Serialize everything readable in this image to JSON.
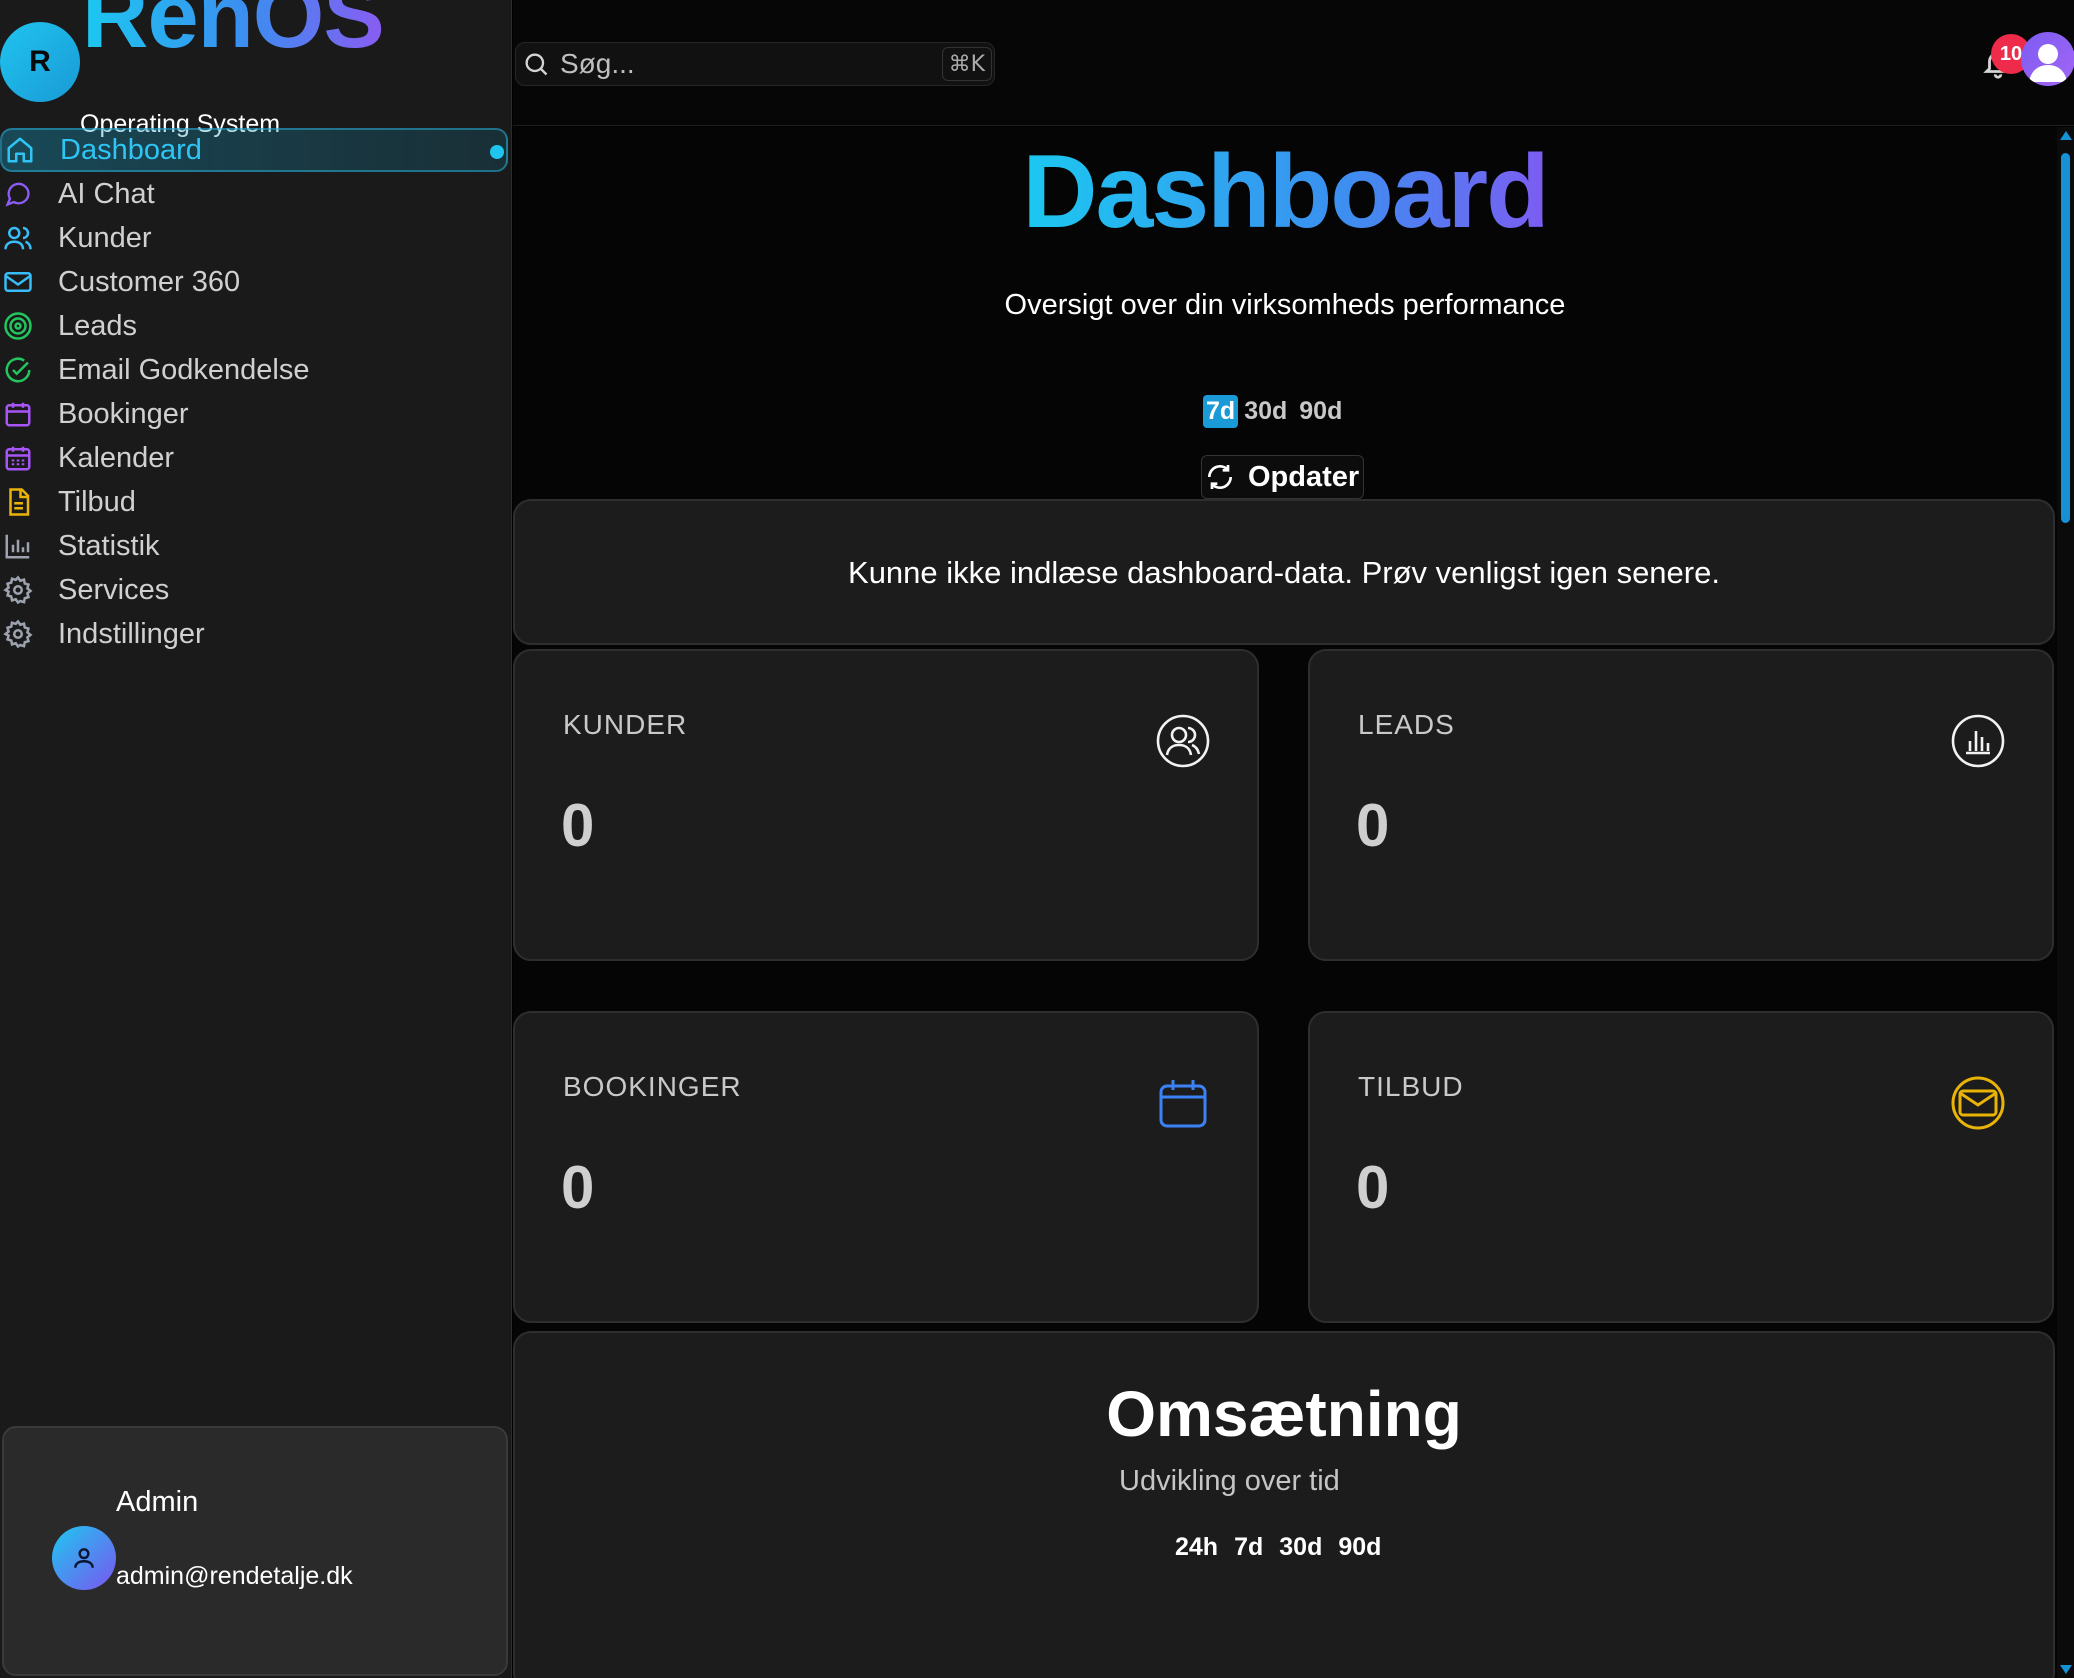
{
  "brand": {
    "logo_letter": "R",
    "name": "RenOS",
    "subtitle": "Operating System"
  },
  "colors": {
    "accent": "#1fc4ef",
    "gradient_end": "#7c5cf2",
    "badge": "#ee2b4b",
    "booking_icon": "#3b82f6",
    "tilbud_icon": "#eab308"
  },
  "sidebar": {
    "items": [
      {
        "label": "Dashboard",
        "icon": "home-icon",
        "active": true
      },
      {
        "label": "AI Chat",
        "icon": "chat-icon"
      },
      {
        "label": "Kunder",
        "icon": "users-icon"
      },
      {
        "label": "Customer 360",
        "icon": "mail-icon"
      },
      {
        "label": "Leads",
        "icon": "target-icon"
      },
      {
        "label": "Email Godkendelse",
        "icon": "check-circle-icon"
      },
      {
        "label": "Bookinger",
        "icon": "calendar-icon"
      },
      {
        "label": "Kalender",
        "icon": "calendar-grid-icon"
      },
      {
        "label": "Tilbud",
        "icon": "document-icon"
      },
      {
        "label": "Statistik",
        "icon": "bar-chart-icon"
      },
      {
        "label": "Services",
        "icon": "gear-icon"
      },
      {
        "label": "Indstillinger",
        "icon": "gear-icon"
      }
    ]
  },
  "user": {
    "name": "Admin",
    "email": "admin@rendetalje.dk"
  },
  "topbar": {
    "search_placeholder": "Søg...",
    "shortcut": "⌘K",
    "notification_count": "10"
  },
  "main": {
    "title": "Dashboard",
    "subtitle": "Oversigt over din virksomheds performance",
    "ranges": [
      "7d",
      "30d",
      "90d"
    ],
    "selected_range": "7d",
    "refresh_label": "Opdater",
    "error_message": "Kunne ikke indlæse dashboard-data. Prøv venligst igen senere.",
    "stats": [
      {
        "label": "KUNDER",
        "value": "0",
        "icon": "users-icon"
      },
      {
        "label": "LEADS",
        "value": "0",
        "icon": "bar-chart-icon"
      },
      {
        "label": "BOOKINGER",
        "value": "0",
        "icon": "calendar-icon"
      },
      {
        "label": "TILBUD",
        "value": "0",
        "icon": "mail-icon"
      }
    ],
    "revenue": {
      "title": "Omsætning",
      "subtitle": "Udvikling over tid",
      "ranges": [
        "24h",
        "7d",
        "30d",
        "90d"
      ]
    }
  }
}
